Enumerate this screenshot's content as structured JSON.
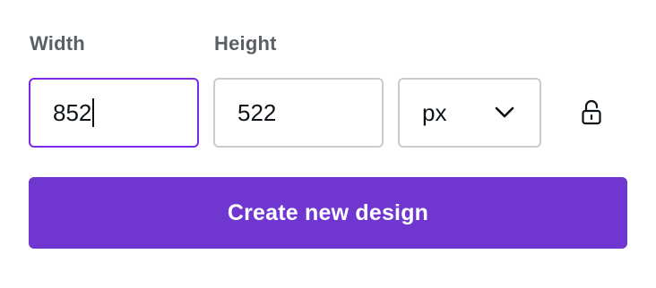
{
  "labels": {
    "width": "Width",
    "height": "Height"
  },
  "inputs": {
    "width_value": "852",
    "height_value": "522",
    "unit_selected": "px"
  },
  "icons": {
    "unit_dropdown": "chevron-down-icon",
    "aspect_lock": "lock-open-icon"
  },
  "actions": {
    "create_label": "Create new design"
  },
  "colors": {
    "accent": "#7d2ae8",
    "button_bg": "#6f36d0",
    "button_text": "#ffffff",
    "label_text": "#5a5f66",
    "input_border": "#c9cbcf"
  }
}
